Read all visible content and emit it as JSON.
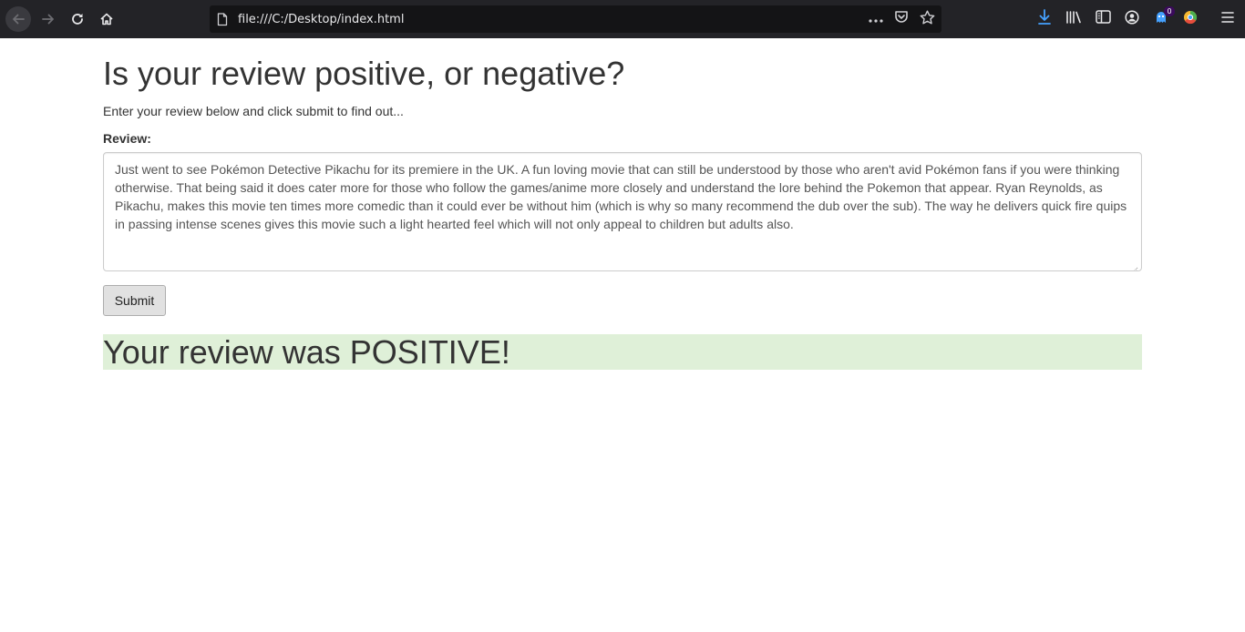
{
  "browser": {
    "url": "file:///C:/Desktop/index.html",
    "extension_badge": "0",
    "colors": {
      "toolbar_bg": "#232327",
      "urlbar_bg": "#141416",
      "download_accent": "#45a1ff"
    },
    "icons": {
      "back": "back-arrow-icon",
      "forward": "forward-arrow-icon",
      "reload": "reload-icon",
      "home": "home-icon",
      "page": "page-icon",
      "more": "more-actions-icon",
      "pocket": "pocket-icon",
      "bookmark": "bookmark-star-icon",
      "download": "download-icon",
      "library": "library-icon",
      "sidebar": "sidebar-icon",
      "account": "account-icon",
      "extension": "extension-icon",
      "color_extension": "color-extension-icon",
      "menu": "hamburger-menu-icon"
    }
  },
  "page": {
    "title": "Is your review positive, or negative?",
    "intro": "Enter your review below and click submit to find out...",
    "review_label": "Review:",
    "review_text": "Just went to see Pokémon Detective Pikachu for its premiere in the UK. A fun loving movie that can still be understood by those who aren't avid Pokémon fans if you were thinking otherwise. That being said it does cater more for those who follow the games/anime more closely and understand the lore behind the Pokemon that appear. Ryan Reynolds, as Pikachu, makes this movie ten times more comedic than it could ever be without him (which is why so many recommend the dub over the sub). The way he delivers quick fire quips in passing intense scenes gives this movie such a light hearted feel which will not only appeal to children but adults also.",
    "submit_label": "Submit",
    "result": "Your review was POSITIVE!",
    "colors": {
      "result_bg": "#dff0d8",
      "text": "#333333"
    }
  }
}
